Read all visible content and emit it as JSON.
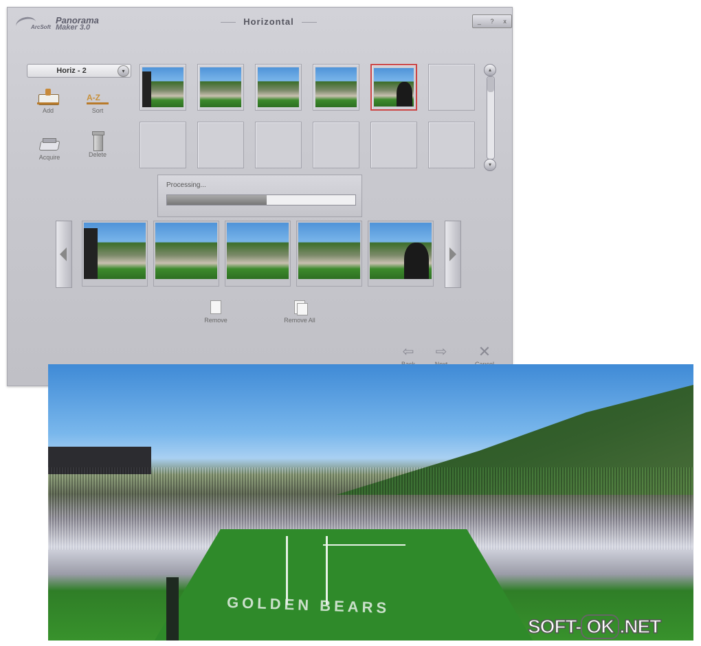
{
  "app": {
    "brand": "ArcSoft",
    "name_line1": "Panorama",
    "name_line2": "Maker 3.0",
    "title": "Horizontal",
    "window_controls": [
      "_",
      "?",
      "x"
    ]
  },
  "album": {
    "selected": "Horiz - 2"
  },
  "tools": [
    {
      "label": "Add",
      "icon": "add-photos-icon"
    },
    {
      "label": "Sort",
      "icon": "sort-az-icon"
    },
    {
      "label": "Acquire",
      "icon": "scanner-icon"
    },
    {
      "label": "Delete",
      "icon": "trash-icon"
    }
  ],
  "thumbnails": {
    "filled": 5,
    "empty": 7,
    "selected_index": 4
  },
  "processing": {
    "label": "Processing...",
    "progress": 0.53
  },
  "strip": {
    "count": 5,
    "selected_index": 4
  },
  "actions": {
    "remove": "Remove",
    "remove_all": "Remove All"
  },
  "nav": {
    "back": "Back",
    "next": "Next",
    "cancel": "Cancel"
  },
  "panorama": {
    "endzone_text": "GOLDEN BEARS"
  },
  "watermark": {
    "left": "SOFT-",
    "ok": "OK",
    "right": ".NET"
  },
  "colors": {
    "selection": "#cc4444",
    "window_bg": "#c9c9cf"
  }
}
